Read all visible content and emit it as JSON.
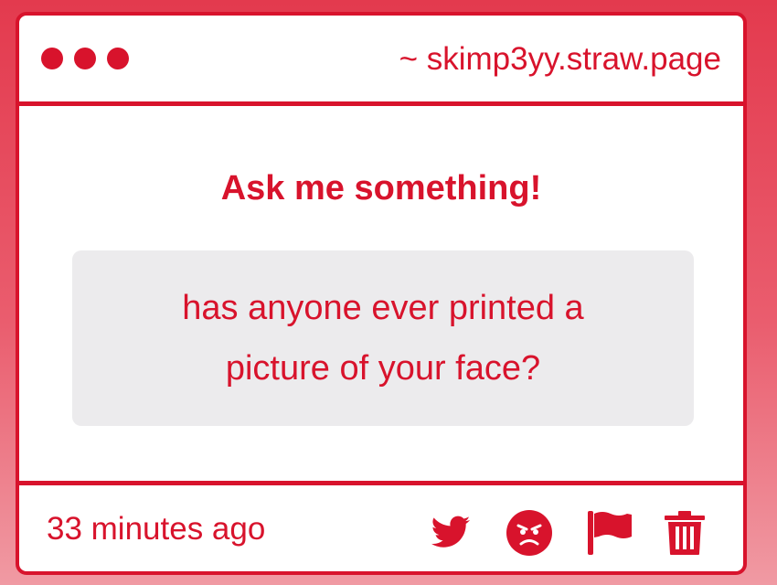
{
  "window": {
    "url": "~ skimp3yy.straw.page"
  },
  "main": {
    "heading": "Ask me something!",
    "question": "has anyone ever printed a picture of your face?"
  },
  "footer": {
    "timestamp": "33 minutes ago",
    "actions": [
      {
        "icon": "twitter-icon"
      },
      {
        "icon": "angry-face-icon"
      },
      {
        "icon": "flag-icon"
      },
      {
        "icon": "trash-icon"
      }
    ]
  },
  "colors": {
    "accent": "#d8132c",
    "question_bg": "#ecebed",
    "background_top": "#e33a4e",
    "background_bottom": "#f09aa3"
  }
}
